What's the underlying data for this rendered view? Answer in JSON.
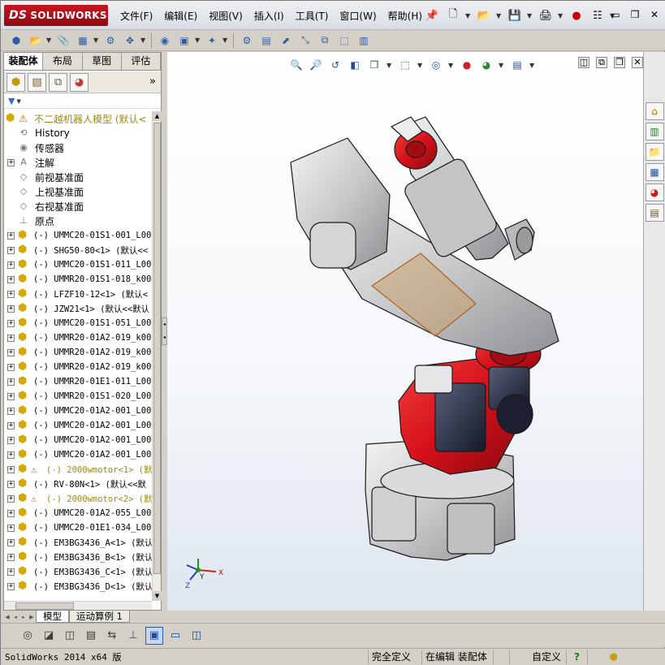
{
  "app": {
    "brand_prefix": "DS",
    "brand": "SOLIDWORKS"
  },
  "menu": [
    "文件(F)",
    "编辑(E)",
    "视图(V)",
    "插入(I)",
    "工具(T)",
    "窗口(W)",
    "帮助(H)"
  ],
  "title_tools": [
    "pin-icon",
    "new-document-icon",
    "open-folder-icon",
    "save-icon",
    "print-icon",
    "rebuild-icon",
    "options-icon"
  ],
  "window_controls": {
    "minimize": "▭",
    "restore": "❐",
    "close": "✕"
  },
  "command_icons": [
    "assembly-icon",
    "insert-component-icon",
    "mate-icon",
    "linear-pattern-icon",
    "smart-fasteners-icon",
    "move-component-icon",
    "show-hidden-icon",
    "assembly-features-icon",
    "reference-geometry-icon",
    "new-motion-study-icon",
    "bill-of-materials-icon",
    "exploded-view-icon",
    "explode-line-icon",
    "interference-icon",
    "instant3d-icon"
  ],
  "panel": {
    "tabs": [
      "装配体",
      "布局",
      "草图",
      "评估"
    ],
    "active_tab": 0,
    "manager_tabs": [
      "feature-manager-icon",
      "property-manager-icon",
      "configuration-manager-icon",
      "display-manager-icon"
    ],
    "expand_label": "»",
    "root": {
      "label": "不二越机器人模型 (默认<"
    },
    "features": [
      {
        "label": "History",
        "icon": "history-icon",
        "expander": false
      },
      {
        "label": "传感器",
        "icon": "sensor-icon",
        "expander": false
      },
      {
        "label": "注解",
        "icon": "annotation-icon",
        "expander": true
      },
      {
        "label": "前视基准面",
        "icon": "plane-icon",
        "expander": false
      },
      {
        "label": "上视基准面",
        "icon": "plane-icon",
        "expander": false
      },
      {
        "label": "右视基准面",
        "icon": "plane-icon",
        "expander": false
      },
      {
        "label": "原点",
        "icon": "origin-icon",
        "expander": false
      }
    ],
    "components": [
      {
        "label": "(-) UMMC20-01S1-001_L00",
        "warn": false
      },
      {
        "label": "(-) SHG50-80<1> (默认<<",
        "warn": false
      },
      {
        "label": "(-) UMMC20-01S1-011_L00",
        "warn": false
      },
      {
        "label": "(-) UMMR20-01S1-018_k00",
        "warn": false
      },
      {
        "label": "(-) LFZF10-12<1> (默认<",
        "warn": false
      },
      {
        "label": "(-) JZW21<1> (默认<<默认",
        "warn": false
      },
      {
        "label": "(-) UMMC20-01S1-051_L00",
        "warn": false
      },
      {
        "label": "(-) UMMR20-01A2-019_k00",
        "warn": false
      },
      {
        "label": "(-) UMMR20-01A2-019_k00",
        "warn": false
      },
      {
        "label": "(-) UMMR20-01A2-019_k00",
        "warn": false
      },
      {
        "label": "(-) UMMR20-01E1-011_L00",
        "warn": false
      },
      {
        "label": "(-) UMMR20-01S1-020_L00",
        "warn": false
      },
      {
        "label": "(-) UMMC20-01A2-001_L00",
        "warn": false
      },
      {
        "label": "(-) UMMC20-01A2-001_L00",
        "warn": false
      },
      {
        "label": "(-) UMMC20-01A2-001_L00",
        "warn": false
      },
      {
        "label": "(-) UMMC20-01A2-001_L00",
        "warn": false
      },
      {
        "label": "(-) 2000wmotor<1> (默",
        "warn": true
      },
      {
        "label": "(-) RV-80N<1> (默认<<默",
        "warn": false
      },
      {
        "label": "(-) 2000wmotor<2> (默",
        "warn": true
      },
      {
        "label": "(-) UMMC20-01A2-055_L00",
        "warn": false
      },
      {
        "label": "(-) UMMC20-01E1-034_L00",
        "warn": false
      },
      {
        "label": "(-) EM3BG3436_A<1> (默认",
        "warn": false
      },
      {
        "label": "(-) EM3BG3436_B<1> (默认",
        "warn": false
      },
      {
        "label": "(-) EM3BG3436_C<1> (默认",
        "warn": false
      },
      {
        "label": "(-) EM3BG3436_D<1> (默认",
        "warn": false
      }
    ]
  },
  "viewport": {
    "hud_icons": [
      "zoom-to-fit-icon",
      "zoom-to-area-icon",
      "previous-view-icon",
      "section-view-icon",
      "view-orientation-icon",
      "display-style-icon",
      "hide-show-items-icon",
      "edit-appearance-icon",
      "apply-scene-icon",
      "view-settings-icon"
    ],
    "controls": [
      "◫",
      "⧉",
      "❐",
      "✕"
    ],
    "triad": {
      "x": "X",
      "y": "Y",
      "z": "Z"
    }
  },
  "task_pane": [
    "solidworks-resources-icon",
    "design-library-icon",
    "file-explorer-icon",
    "view-palette-icon",
    "appearances-icon",
    "custom-properties-icon"
  ],
  "bottom_tabs": [
    "模型",
    "运动算例 1"
  ],
  "bottom_active": 0,
  "view_toolbar": [
    "view-icon-1",
    "view-icon-2",
    "view-icon-3",
    "view-icon-4",
    "view-icon-5",
    "view-icon-6",
    "shaded-view-icon",
    "single-view-icon",
    "two-view-icon"
  ],
  "view_toolbar_active": 6,
  "status": {
    "app": "SolidWorks 2014 x64 版",
    "defined": "完全定义",
    "editing": "在编辑 装配体",
    "units": "自定义",
    "help": "?",
    "rebuild": "rebuild-notice-icon"
  },
  "colors": {
    "accent_red": "#d6101a",
    "robot_grey": "#c8c9cb",
    "tree_olive": "#9a8a14",
    "brand_red": "#c8141e"
  }
}
